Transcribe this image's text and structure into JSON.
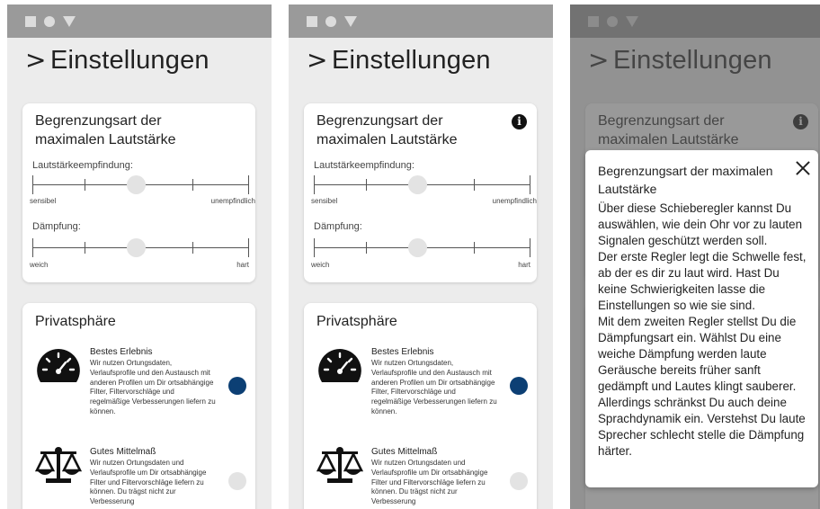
{
  "header": {
    "chevron": ">",
    "title": "Einstellungen"
  },
  "limit_card": {
    "title": "Begrenzungsart der maximalen Lautstärke",
    "info_icon_glyph": "i",
    "slider1": {
      "label": "Lautstärkeempfindung:",
      "min_label": "sensibel",
      "max_label": "unempfindlich",
      "value": 0.5
    },
    "slider2": {
      "label": "Dämpfung:",
      "min_label": "weich",
      "max_label": "hart",
      "value": 0.5
    }
  },
  "privacy_card": {
    "title": "Privatsphäre",
    "options": [
      {
        "icon": "speedometer-icon",
        "title": "Bestes Erlebnis",
        "description": "Wir nutzen Ortungsdaten, Verlaufsprofile und den Austausch mit anderen Profilen um Dir ortsabhängige Filter, Filtervorschläge und regelmäßige Verbesserungen liefern zu können.",
        "selected": true
      },
      {
        "icon": "balance-scale-icon",
        "title": "Gutes Mittelmaß",
        "description": "Wir nutzen Ortungsdaten und Verlaufsprofile um Dir ortsabhängige Filter und Filtervorschläge liefern zu können. Du trägst nicht zur Verbesserung",
        "selected": false
      }
    ]
  },
  "dialog": {
    "title": "Begrenzungsart der maximalen Lautstärke",
    "body": "Über diese Schieberegler kannst Du auswählen, wie dein Ohr vor zu lauten Signalen geschützt werden soll.\nDer erste Regler legt die Schwelle fest, ab der es dir zu laut wird. Hast Du keine Schwierigkeiten lasse die Einstellungen so wie sie sind.\nMit dem zweiten Regler stellst Du die Dämpfungsart ein. Wählst Du eine weiche Dämpfung werden laute Geräusche bereits früher sanft gedämpft und Lautes klingt sauberer. Allerdings schränkst Du auch deine Sprachdynamik ein. Verstehst Du laute Sprecher schlecht stelle die Dämpfung härter."
  },
  "colors": {
    "accent": "#0c3f74",
    "statusbar": "#9a9a9a",
    "background": "#ececec"
  }
}
